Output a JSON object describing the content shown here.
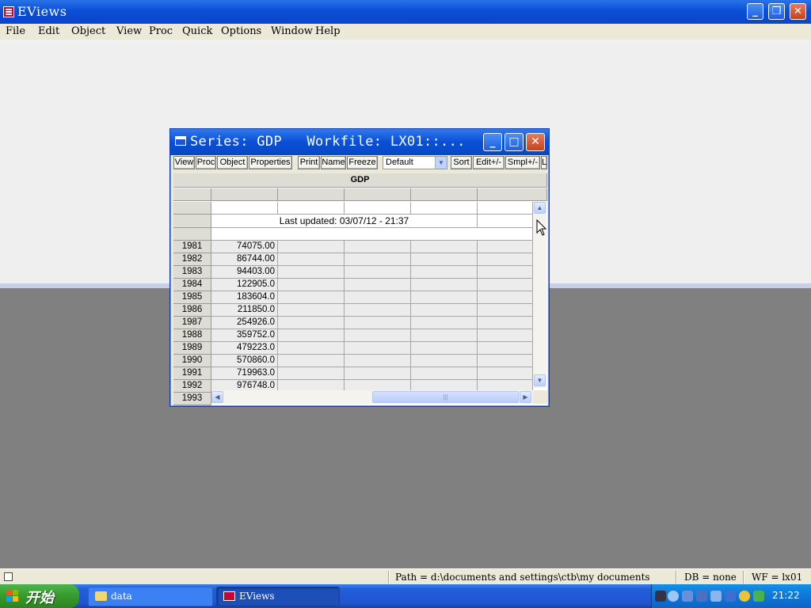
{
  "app": {
    "title": "EViews"
  },
  "menu": [
    "File",
    "Edit",
    "Object",
    "View",
    "Proc",
    "Quick",
    "Options",
    "Window",
    "Help"
  ],
  "series_window": {
    "title": "Series: GDP   Workfile: LX01::...",
    "toolbar": {
      "buttons": [
        "View",
        "Proc",
        "Object",
        "Properties",
        "Print",
        "Name",
        "Freeze"
      ],
      "combo_value": "Default",
      "buttons2": [
        "Sort",
        "Edit+/-",
        "Smpl+/-",
        "L"
      ]
    },
    "column_header": "GDP",
    "last_updated": "Last updated: 03/07/12 - 21:37",
    "rows": [
      {
        "year": "1981",
        "value": "74075.00"
      },
      {
        "year": "1982",
        "value": "86744.00"
      },
      {
        "year": "1983",
        "value": "94403.00"
      },
      {
        "year": "1984",
        "value": "122905.0"
      },
      {
        "year": "1985",
        "value": "183604.0"
      },
      {
        "year": "1986",
        "value": "211850.0"
      },
      {
        "year": "1987",
        "value": "254926.0"
      },
      {
        "year": "1988",
        "value": "359752.0"
      },
      {
        "year": "1989",
        "value": "479223.0"
      },
      {
        "year": "1990",
        "value": "570860.0"
      },
      {
        "year": "1991",
        "value": "719963.0"
      },
      {
        "year": "1992",
        "value": "976748.0"
      },
      {
        "year": "1993",
        "value": ""
      }
    ]
  },
  "status": {
    "path": "Path = d:\\documents and settings\\ctb\\my documents",
    "db": "DB = none",
    "wf": "WF = lx01"
  },
  "taskbar": {
    "start_label": "开始",
    "tasks": [
      "data",
      "EViews"
    ],
    "clock": "21:22"
  }
}
